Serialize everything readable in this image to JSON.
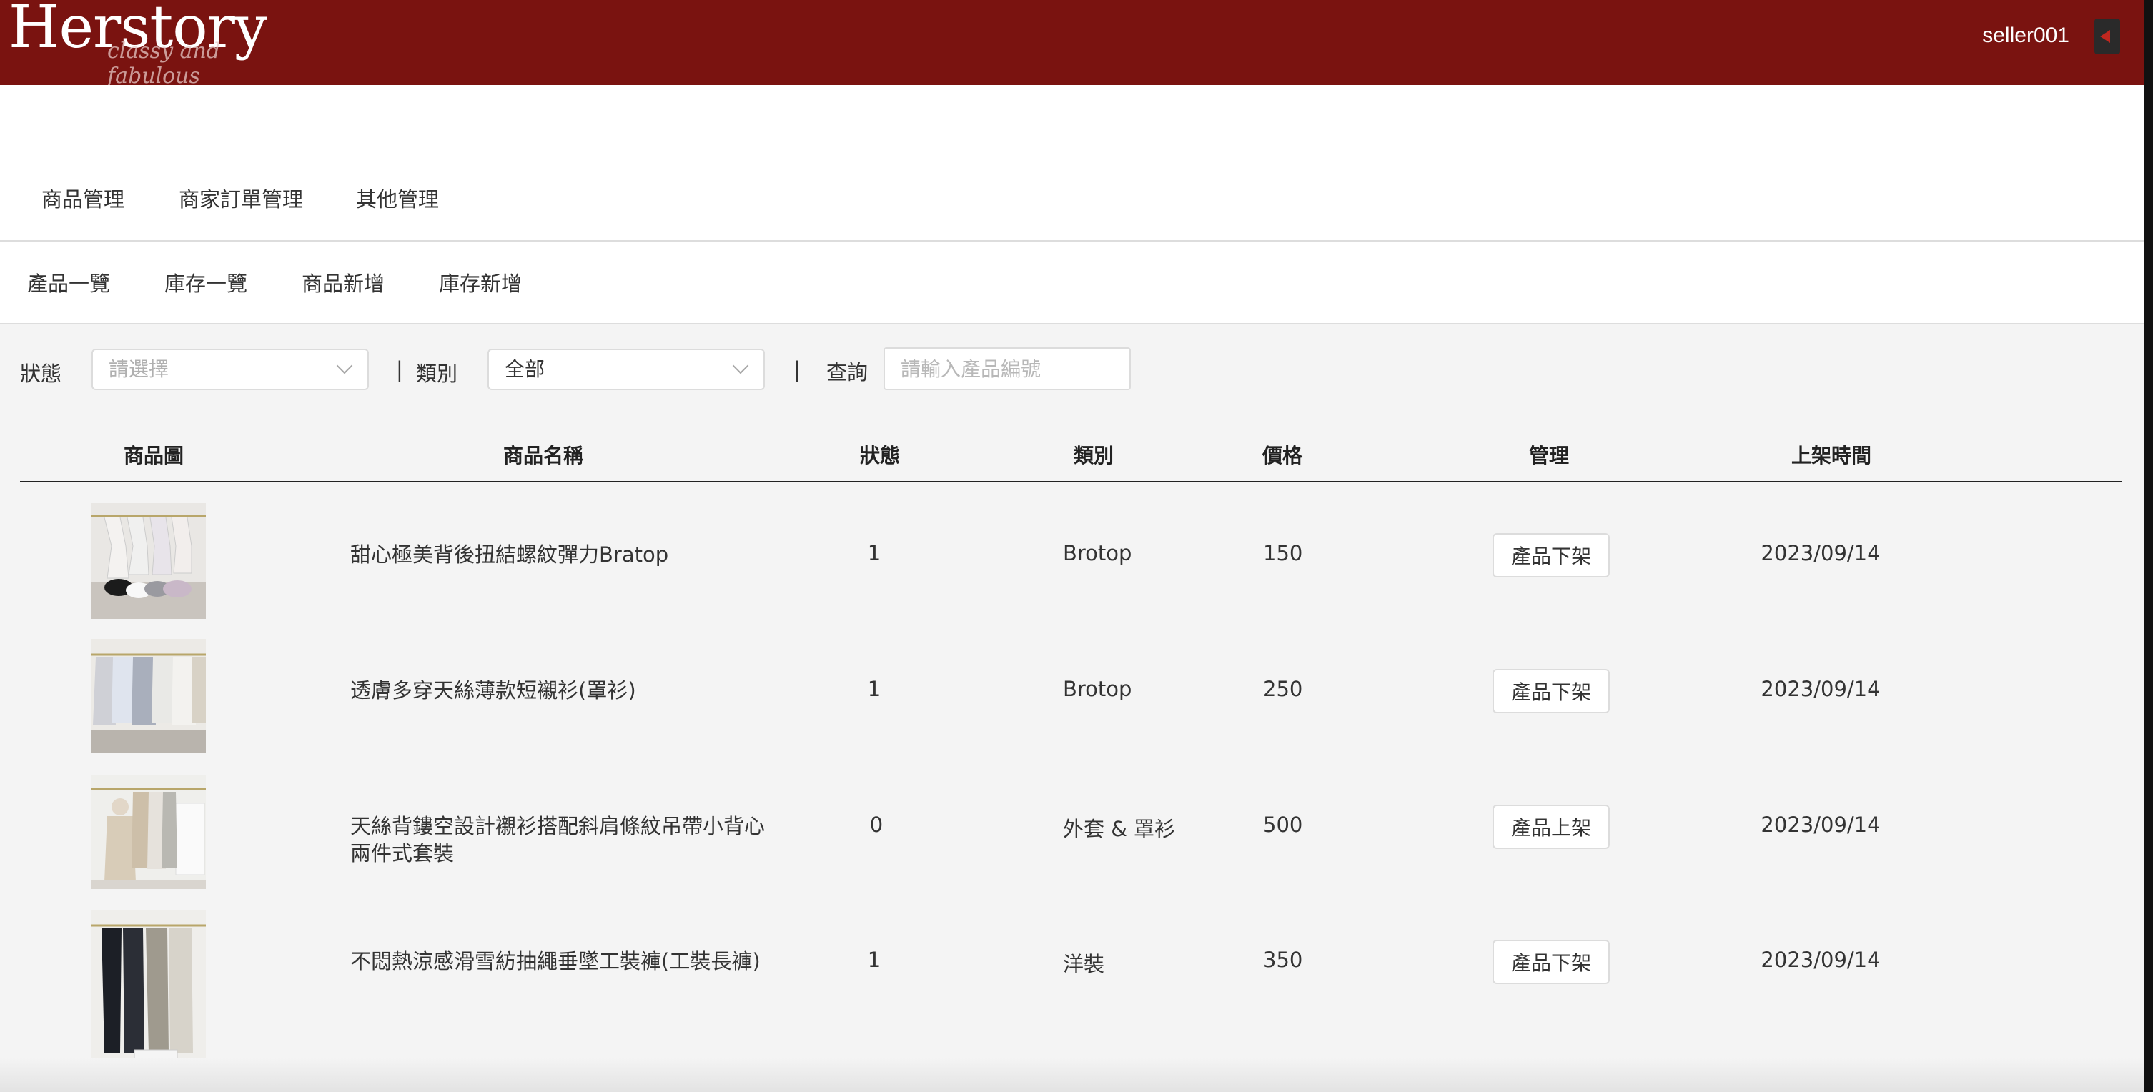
{
  "header": {
    "logo_text": "Herstory",
    "logo_tagline": "classy and fabulous",
    "username": "seller001",
    "logout_icon": "logout-icon"
  },
  "nav": {
    "main": [
      "商品管理",
      "商家訂單管理",
      "其他管理"
    ],
    "sub": [
      "產品一覽",
      "庫存一覽",
      "商品新增",
      "庫存新增"
    ]
  },
  "filters": {
    "status_label": "狀態",
    "status_placeholder": "請選擇",
    "category_label": "類別",
    "category_value": "全部",
    "search_label": "查詢",
    "search_placeholder": "請輸入產品編號",
    "separator": "|"
  },
  "table": {
    "headers": [
      "商品圖",
      "商品名稱",
      "狀態",
      "類別",
      "價格",
      "管理",
      "上架時間"
    ],
    "rows": [
      {
        "name": "甜心極美背後扭結螺紋彈力Bratop",
        "status": "1",
        "category": "Brotop",
        "price": "150",
        "action": "產品下架",
        "date": "2023/09/14"
      },
      {
        "name": "透膚多穿天絲薄款短襯衫(罩衫)",
        "status": "1",
        "category": "Brotop",
        "price": "250",
        "action": "產品下架",
        "date": "2023/09/14"
      },
      {
        "name": "天絲背鏤空設計襯衫搭配斜肩條紋吊帶小背心兩件式套裝",
        "status": "0",
        "category": "外套 & 罩衫",
        "price": "500",
        "action": "產品上架",
        "date": "2023/09/14"
      },
      {
        "name": "不悶熱涼感滑雪紡抽繩垂墜工裝褲(工裝長褲)",
        "status": "1",
        "category": "洋裝",
        "price": "350",
        "action": "產品下架",
        "date": "2023/09/14"
      }
    ]
  }
}
